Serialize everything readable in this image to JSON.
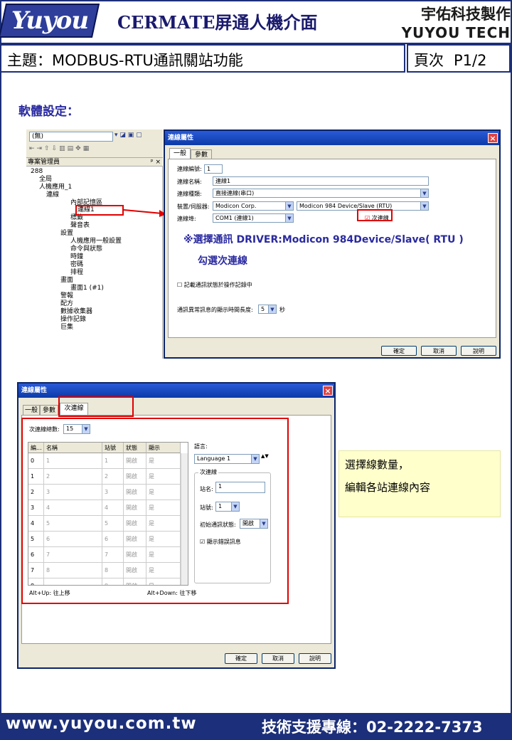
{
  "header": {
    "logo": "Yuyou",
    "title": "CERMATE屏通人機介面",
    "brand_cn": "宇佑科技製作",
    "brand_en": "YUYOU TECH"
  },
  "subject": {
    "label": "主題：MODBUS-RTU通訊關站功能"
  },
  "page": {
    "label": "頁次",
    "number": "P1/2"
  },
  "section_title": "軟體設定：",
  "tree": {
    "select_value": "(無)",
    "panel_title": "專案管理員",
    "items": [
      "288",
      "全局",
      "人機應用_1",
      "連線",
      "內部記憶區",
      "連線1",
      "標籤",
      "聲音表",
      "設置",
      "人機應用一般設置",
      "命令與狀態",
      "時鐘",
      "密碼",
      "排程",
      "畫面",
      "畫面1 (#1)",
      "警報",
      "配方",
      "數據收集器",
      "操作記錄",
      "巨集"
    ]
  },
  "dialog1": {
    "title": "連線屬性",
    "tabs": [
      "一般",
      "參數"
    ],
    "fields": {
      "link_no_label": "連線編號:",
      "link_no_value": "1",
      "link_name_label": "連線名稱:",
      "link_name_value": "連線1",
      "link_type_label": "連線種類:",
      "link_type_value": "直接連線(串口)",
      "device_label": "裝置/伺服器:",
      "device_vendor": "Modicon Corp.",
      "device_model": "Modicon 984 Device/Slave (RTU)",
      "port_label": "連線埠:",
      "port_value": "COM1 (連線1)",
      "sub_link": "次連線",
      "log_checkbox": "記載通訊狀態於操作記錄中",
      "time_label": "通訊異常訊息的顯示時間長度:",
      "time_value": "5",
      "time_unit": "秒"
    },
    "buttons": [
      "確定",
      "取消",
      "說明"
    ]
  },
  "note1": "※選擇通訊 DRIVER:Modicon  984Device/Slave( RTU )",
  "note2": "勾選次連線",
  "dialog2": {
    "title": "連線屬性",
    "tabs": [
      "一般",
      "參數",
      "次連線"
    ],
    "count_label": "次連線總數:",
    "count_value": "15",
    "columns": [
      "編...",
      "名稱",
      "站號",
      "狀態",
      "顯示"
    ],
    "rows": [
      [
        "0",
        "1",
        "1",
        "開啟",
        "是"
      ],
      [
        "1",
        "2",
        "2",
        "開啟",
        "是"
      ],
      [
        "2",
        "3",
        "3",
        "開啟",
        "是"
      ],
      [
        "3",
        "4",
        "4",
        "開啟",
        "是"
      ],
      [
        "4",
        "5",
        "5",
        "開啟",
        "是"
      ],
      [
        "5",
        "6",
        "6",
        "開啟",
        "是"
      ],
      [
        "6",
        "7",
        "7",
        "開啟",
        "是"
      ],
      [
        "7",
        "8",
        "8",
        "開啟",
        "是"
      ],
      [
        "8",
        "",
        "9",
        "開啟",
        "是"
      ]
    ],
    "footer_left": "Alt+Up: 往上移",
    "footer_right": "Alt+Down: 往下移",
    "lang_label": "語言:",
    "lang_value": "Language 1",
    "group_label": "次連線",
    "name_label": "站名:",
    "name_value": "1",
    "station_label": "站號:",
    "station_value": "1",
    "init_label": "初始通訊狀態:",
    "init_value": "開啟",
    "show_error": "顯示錯誤訊息",
    "buttons": [
      "確定",
      "取消",
      "說明"
    ]
  },
  "note_box": {
    "line1": "選擇線數量，",
    "line2": "編輯各站連線內容"
  },
  "footer": {
    "website": "www.yuyou.com.tw",
    "hotline": "技術支援專線：02-2222-7373"
  }
}
